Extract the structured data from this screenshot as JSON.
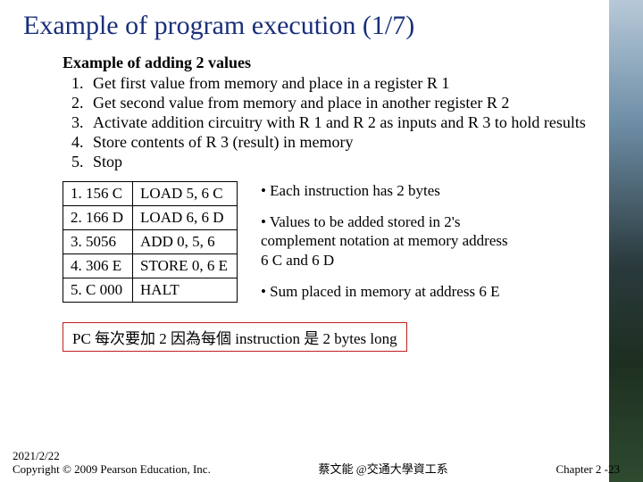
{
  "title": "Example of program execution (1/7)",
  "subtitle": "Example of adding 2 values",
  "steps": [
    "Get first value from memory and place in a register R 1",
    "Get second value from memory and place in another register R 2",
    "Activate addition circuitry with R 1 and R 2 as inputs and R 3 to hold results",
    "Store contents of R 3 (result) in memory",
    "Stop"
  ],
  "instr": [
    {
      "code": "1. 156 C",
      "mnem": "LOAD 5, 6 C"
    },
    {
      "code": "2. 166 D",
      "mnem": "LOAD 6, 6 D"
    },
    {
      "code": "3. 5056",
      "mnem": "ADD 0, 5, 6"
    },
    {
      "code": "4. 306 E",
      "mnem": "STORE 0, 6 E"
    },
    {
      "code": "5. C 000",
      "mnem": "HALT"
    }
  ],
  "notes": [
    "• Each instruction has 2 bytes",
    "• Values to be added stored in 2's complement notation at memory address 6 C and 6 D",
    "• Sum placed in memory at address 6 E"
  ],
  "pc_note": "PC 每次要加 2 因為每個 instruction 是 2 bytes long",
  "footer": {
    "date": "2021/2/22",
    "copyright": "Copyright © 2009 Pearson Education, Inc.",
    "author": "蔡文能 @交通大學資工系",
    "page": "Chapter 2 -23"
  }
}
